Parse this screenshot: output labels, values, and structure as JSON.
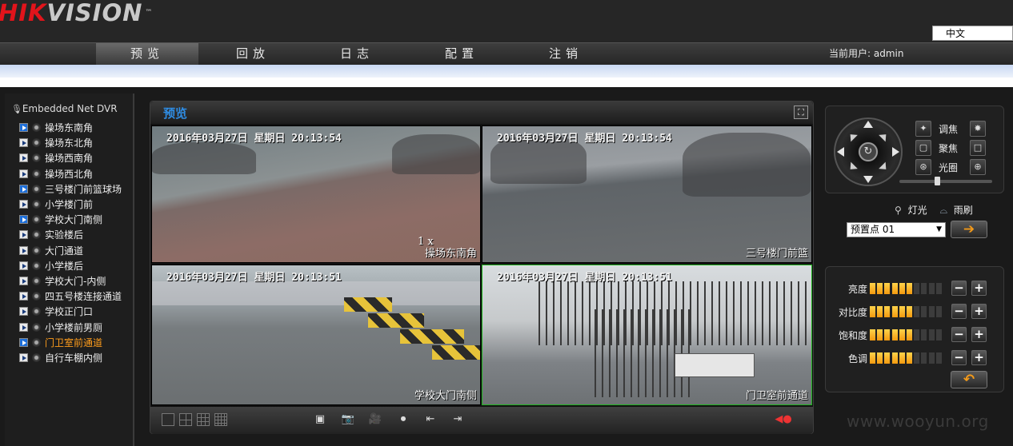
{
  "brand": {
    "logo_red": "HIK",
    "logo_gray": "VISION",
    "tm": "™"
  },
  "language": {
    "selected": "中文"
  },
  "nav": {
    "items": [
      "预览",
      "回放",
      "日志",
      "配置",
      "注销"
    ],
    "active_index": 0
  },
  "user": {
    "label": "当前用户: admin"
  },
  "tree": {
    "root": "Embedded Net DVR",
    "channels": [
      {
        "label": "操场东南角",
        "playing": true
      },
      {
        "label": "操场东北角",
        "playing": false
      },
      {
        "label": "操场西南角",
        "playing": false
      },
      {
        "label": "操场西北角",
        "playing": false
      },
      {
        "label": "三号楼门前篮球场",
        "playing": true
      },
      {
        "label": "小学楼门前",
        "playing": false
      },
      {
        "label": "学校大门南侧",
        "playing": true
      },
      {
        "label": "实验楼后",
        "playing": false
      },
      {
        "label": "大门通道",
        "playing": false
      },
      {
        "label": "小学楼后",
        "playing": false
      },
      {
        "label": "学校大门-内侧",
        "playing": false
      },
      {
        "label": "四五号楼连接通道",
        "playing": false
      },
      {
        "label": "学校正门口",
        "playing": false
      },
      {
        "label": "小学楼前男厕",
        "playing": false
      },
      {
        "label": "门卫室前通道",
        "playing": true,
        "selected": true
      },
      {
        "label": "自行车棚内侧",
        "playing": false
      }
    ]
  },
  "preview": {
    "title": "预览",
    "videos": [
      {
        "timestamp": "2016年03月27日 星期日 20:13:54",
        "name": "操场东南角",
        "zoom": "1 x"
      },
      {
        "timestamp": "2016年03月27日 星期日 20:13:54",
        "name": "三号楼门前篮"
      },
      {
        "timestamp": "2016年03月27日 星期日 20:13:51",
        "name": "学校大门南侧"
      },
      {
        "timestamp": "2016年03月27日 星期日 20:13:51",
        "name": "门卫室前通道",
        "selected": true
      }
    ]
  },
  "toolbar": {
    "layouts": [
      "1x1",
      "2x2",
      "3x3",
      "4x4"
    ],
    "actions": [
      "stop-all-icon",
      "capture-icon",
      "record-all-icon",
      "stop-record-icon",
      "prev-page-icon",
      "next-page-icon",
      "volume-icon"
    ]
  },
  "ptz": {
    "zoom": "调焦",
    "focus": "聚焦",
    "iris": "光圈",
    "speed_level": 0.4,
    "light": "灯光",
    "wiper": "雨刷",
    "preset": "预置点 01"
  },
  "image_adjust": [
    {
      "label": "亮度",
      "level": 6,
      "max": 10
    },
    {
      "label": "对比度",
      "level": 6,
      "max": 10
    },
    {
      "label": "饱和度",
      "level": 6,
      "max": 10
    },
    {
      "label": "色调",
      "level": 6,
      "max": 10
    }
  ],
  "watermark": "www.wooyun.org",
  "colors": {
    "accent_blue": "#2f8de4",
    "selected_orange": "#ff9d1c",
    "brand_red": "#e2141b",
    "selected_border": "#1fb31f"
  }
}
